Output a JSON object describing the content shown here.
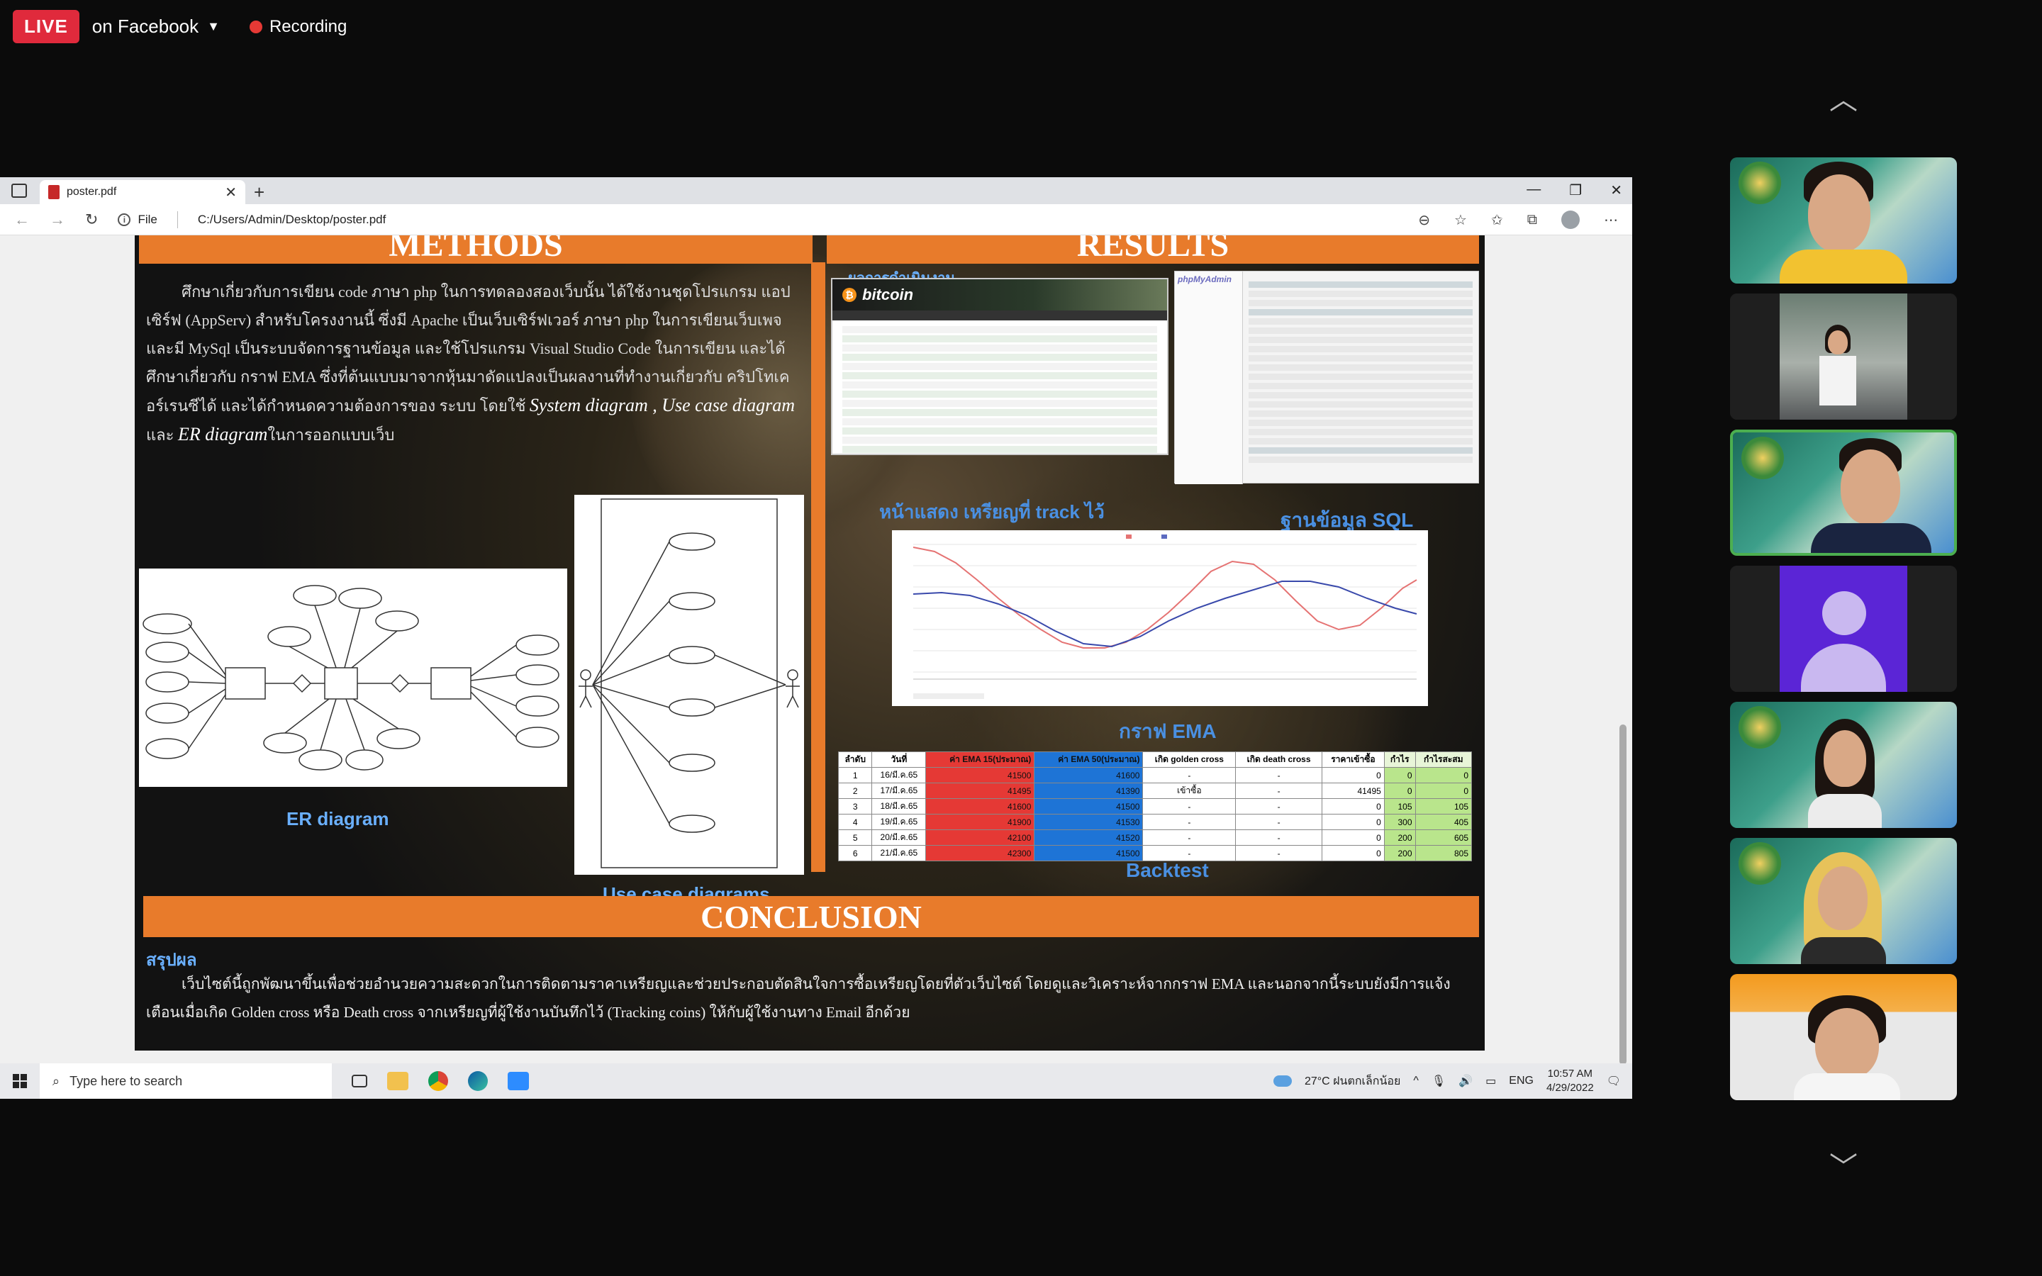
{
  "stream": {
    "live_badge": "LIVE",
    "destination": "on Facebook",
    "recording": "Recording"
  },
  "browser": {
    "tab_title": "poster.pdf",
    "address_prefix": "File",
    "url": "C:/Users/Admin/Desktop/poster.pdf"
  },
  "poster": {
    "methods_heading": "METHODS",
    "results_heading": "RESULTS",
    "methods_text_a": "ศึกษาเกี่ยวกับการเขียน code ภาษา php ในการทดลองสองเว็บนั้น ได้ใช้งานชุดโปรแกรม แอปเซิร์ฟ (AppServ) สำหรับโครงงานนี้ ซึ่งมี Apache เป็นเว็บเซิร์ฟเวอร์ ภาษา php ในการเขียนเว็บเพจ และมี MySql เป็นระบบจัดการฐานข้อมูล และใช้โปรแกรม Visual Studio Code ในการเขียน และได้ศึกษาเกี่ยวกับ กราฟ EMA ซึ่งที่ต้นแบบมาจากหุ้นมาดัดแปลงเป็นผลงานที่ทำงานเกี่ยวกับ คริปโทเคอร์เรนซีได้ และได้กำหนดความต้องการของ ระบบ โดยใช้",
    "methods_text_b": "System diagram , Use case diagram",
    "methods_text_c": "และ",
    "methods_text_d": "ER diagram",
    "methods_text_e": "ในการออกแบบเว็บ",
    "er_label": "ER diagram",
    "uc_label": "Use case diagrams",
    "web_title": "ผลการดำเนินงาน",
    "bitcoin_brand": "bitcoin",
    "track_label": "หน้าแสดง เหรียญที่ track ไว้",
    "sql_label": "ฐานข้อมูล SQL",
    "ema_label": "กราฟ EMA",
    "backtest_label": "Backtest",
    "conclusion_heading": "CONCLUSION",
    "conclusion_sub": "สรุปผล",
    "conclusion_text": "เว็บไซต์นี้ถูกพัฒนาขึ้นเพื่อช่วยอำนวยความสะดวกในการติดตามราคาเหรียญและช่วยประกอบตัดสินใจการซื้อเหรียญโดยที่ตัวเว็บไซต์ โดยดูและวิเคราะห์จากกราฟ EMA และนอกจากนี้ระบบยังมีการแจ้งเตือนเมื่อเกิด Golden cross หรือ Death cross จากเหรียญที่ผู้ใช้งานบันทึกไว้ (Tracking coins) ให้กับผู้ใช้งานทาง Email อีกด้วย"
  },
  "backtest": {
    "headers": [
      "ลำดับ",
      "วันที่",
      "ค่า EMA 15(ประมาณ)",
      "ค่า EMA 50(ประมาณ)",
      "เกิด golden cross",
      "เกิด death cross",
      "ราคาเข้าซื้อ",
      "กำไร",
      "กำไรสะสม"
    ],
    "rows": [
      [
        "1",
        "16/มี.ค.65",
        "41500",
        "41600",
        "-",
        "-",
        "0",
        "0",
        "0"
      ],
      [
        "2",
        "17/มี.ค.65",
        "41495",
        "41390",
        "เข้าซื้อ",
        "-",
        "41495",
        "0",
        "0"
      ],
      [
        "3",
        "18/มี.ค.65",
        "41600",
        "41500",
        "-",
        "-",
        "0",
        "105",
        "105"
      ],
      [
        "4",
        "19/มี.ค.65",
        "41900",
        "41530",
        "-",
        "-",
        "0",
        "300",
        "405"
      ],
      [
        "5",
        "20/มี.ค.65",
        "42100",
        "41520",
        "-",
        "-",
        "0",
        "200",
        "605"
      ],
      [
        "6",
        "21/มี.ค.65",
        "42300",
        "41500",
        "-",
        "-",
        "0",
        "200",
        "805"
      ]
    ]
  },
  "taskbar": {
    "search_placeholder": "Type here to search",
    "weather": "27°C ฝนตกเล็กน้อย",
    "lang": "ENG",
    "time": "10:57 AM",
    "date": "4/29/2022"
  },
  "colors": {
    "live_red": "#e02a3c",
    "poster_orange": "#e87b2b",
    "label_blue": "#4a90e2",
    "active_tile": "#4caf50"
  }
}
